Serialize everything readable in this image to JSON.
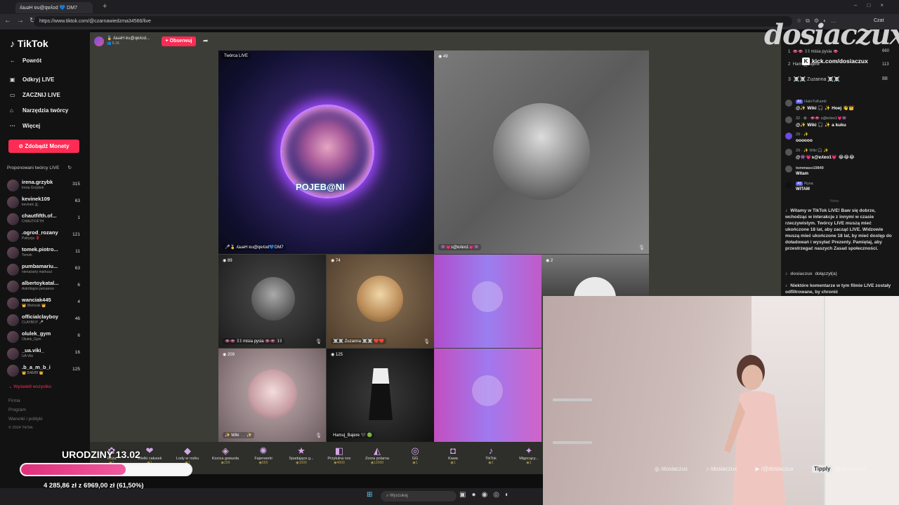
{
  "browser": {
    "tab_title": "ʎaɹəH ɐu@qɐʎod 💙 DM7",
    "url": "https://www.tiktok.com/@czarnawiedzma34566/live",
    "copilot_label": "Czat"
  },
  "sidebar": {
    "logo": "TikTok",
    "nav": [
      {
        "icon": "←",
        "label": "Powrót"
      },
      {
        "icon": "▣",
        "label": "Odkryj LIVE"
      },
      {
        "icon": "▭",
        "label": "ZACZNIJ LIVE"
      },
      {
        "icon": "⌂",
        "label": "Narzędzia twórcy"
      },
      {
        "icon": "···",
        "label": "Więcej"
      }
    ],
    "coins_button": "Zdobądź Monety",
    "suggested_heading": "Proponowani twórcy LIVE",
    "creators": [
      {
        "name": "irena.grzybk",
        "sub": "Irena Grzybek",
        "count": "315"
      },
      {
        "name": "kevinek109",
        "sub": "kevinek 🎩",
        "count": "63"
      },
      {
        "name": "chautfifth.of...",
        "sub": "CHAUTFIFTH",
        "count": "1"
      },
      {
        "name": ".ogrod_rozany",
        "sub": "Patrycja 🌹",
        "count": "121"
      },
      {
        "name": "tomek.piotro...",
        "sub": "Tomek",
        "count": "11"
      },
      {
        "name": "pumbamariu...",
        "sub": "nienażarty markusz",
        "count": "63"
      },
      {
        "name": "albertoykatal...",
        "sub": "Astrólogos peruanos",
        "count": "6"
      },
      {
        "name": "wanciak445",
        "sub": "👑 Wańciak 👑",
        "count": "4"
      },
      {
        "name": "officialclayboy",
        "sub": "CLAYBOY 🎤",
        "count": "46"
      },
      {
        "name": "olulek_gym",
        "sub": "Olulek_Gym",
        "count": "6"
      },
      {
        "name": "_ua.viki_",
        "sub": "UA Viki",
        "count": "16"
      },
      {
        "name": ".b_a_m_b_i",
        "sub": "👑 𝐵𝐴𝑀𝐵𝐼 👑",
        "count": "125"
      }
    ],
    "show_all": "Wyświetl wszystko",
    "footer": [
      "Firma",
      "Program",
      "Warunki i polityki",
      "© 2024 TikTok"
    ]
  },
  "live": {
    "host_name": "🏅 ʎaɹəH ɐu@qɐʎod...",
    "host_sub": "👥 6.1K",
    "follow_button": "+ Obserwuj",
    "creator_badge": "Twórca LIVE",
    "main_card_text": "POJEB@NI",
    "tiles": [
      {
        "id": "host",
        "viewers": "",
        "label": "🎤🏅 ʎaɹəH ɐu@qɐʎod💙DM7"
      },
      {
        "id": "guest-top",
        "viewers": "49",
        "label": "👾💗s@ɐʎɐo1💗👾"
      },
      {
        "id": "g1",
        "viewers": "89",
        "label": "👄👄 𝟛𝟛 misia pysia 👄👄 𝟛𝟛"
      },
      {
        "id": "g2",
        "viewers": "74",
        "label": "☠️☠️ Zuzanna ☠️☠️ ❤️❤️"
      },
      {
        "id": "g3",
        "viewers": "",
        "label": ""
      },
      {
        "id": "g4",
        "viewers": "2",
        "label": ""
      },
      {
        "id": "g5",
        "viewers": "209",
        "label": "✨ Wiki 🎧 ✨"
      },
      {
        "id": "g6",
        "viewers": "125",
        "label": "Hamuj_Bajere 🖤 🟢"
      },
      {
        "id": "g7",
        "viewers": "",
        "label": ""
      }
    ],
    "gifts": [
      {
        "name": "Róża",
        "price": "1"
      },
      {
        "name": "Wielki całusek",
        "price": "1"
      },
      {
        "name": "Lody w rożku",
        "price": "1"
      },
      {
        "name": "Kocica gwiazda",
        "price": "199"
      },
      {
        "name": "Fajerwerki",
        "price": "500"
      },
      {
        "name": "Spadające g...",
        "price": "1500"
      },
      {
        "name": "Przytulna noc",
        "price": "4000"
      },
      {
        "name": "Zorza polarna",
        "price": "12000"
      },
      {
        "name": "GG",
        "price": "1"
      },
      {
        "name": "Kawa",
        "price": "1"
      },
      {
        "name": "TikTok",
        "price": "1"
      },
      {
        "name": "Migocący...",
        "price": "1"
      }
    ]
  },
  "chat": {
    "top_rows": [
      {
        "rank": "1",
        "name": "👄👄 𝟛𝟛 misia pysia 👄",
        "score": "660"
      },
      {
        "rank": "2",
        "name": "Hamuj_Bajere",
        "score": "113"
      },
      {
        "rank": "3",
        "name": "☠️☠️ Zuzanna ☠️☠️",
        "score": "88"
      }
    ],
    "messages": [
      {
        "meta": "HaloYuKamil",
        "text": "@✨ Wiki 🎧 ✨ Hoej 👋👑"
      },
      {
        "meta": "32 · ✿ · 👄👄 s@ɐʎɐo1💗👾",
        "text": "@✨ Wiki 🎧 ✨ a kuku"
      },
      {
        "meta": "29 · ✨",
        "text": "oooooo"
      },
      {
        "meta": "29 · ✨ Wiki 🎧 ✨",
        "text": "@👾💗s@ɐʎɐo1💗 😂😂😂"
      },
      {
        "meta": "tommaso19849",
        "text": "Witam"
      },
      {
        "meta": "Rysa",
        "text": "WITAM"
      }
    ],
    "divider": "Nowy",
    "system_message": "Witamy w TikTok LIVE! Baw się dobrze, wchodząc w interakcje z innymi w czasie rzeczywistym. Twórcy LIVE muszą mieć ukończone 18 lat, aby zacząć LIVE. Widzowie muszą mieć ukończone 18 lat, by mieć dostęp do doładowań i wysyłać Prezenty. Pamiętaj, aby przestrzegać naszych Zasad społeczności.",
    "join_name": "dosiaczux",
    "join_text": "dołączył(a)",
    "filter_notice": "Niektóre komentarze w tym filmie LIVE zostały odfiltrowane, by chronić"
  },
  "overlay": {
    "logo_text": "dosiaczux",
    "kick_text": "kick.com/dosiaczux",
    "socials": [
      "/dosiaczux",
      "/dosiaczux",
      "/@dosiaczux"
    ],
    "tipply_label": "Tipply",
    "tipply_handle": "/@dosiaczux",
    "birthday_title": "URODZINY 13.02",
    "birthday_amount": "4 285,86 zł z 6969,00 zł (61,50%)",
    "progress_fraction": 0.615,
    "taskbar_search": "Wyszukaj"
  }
}
